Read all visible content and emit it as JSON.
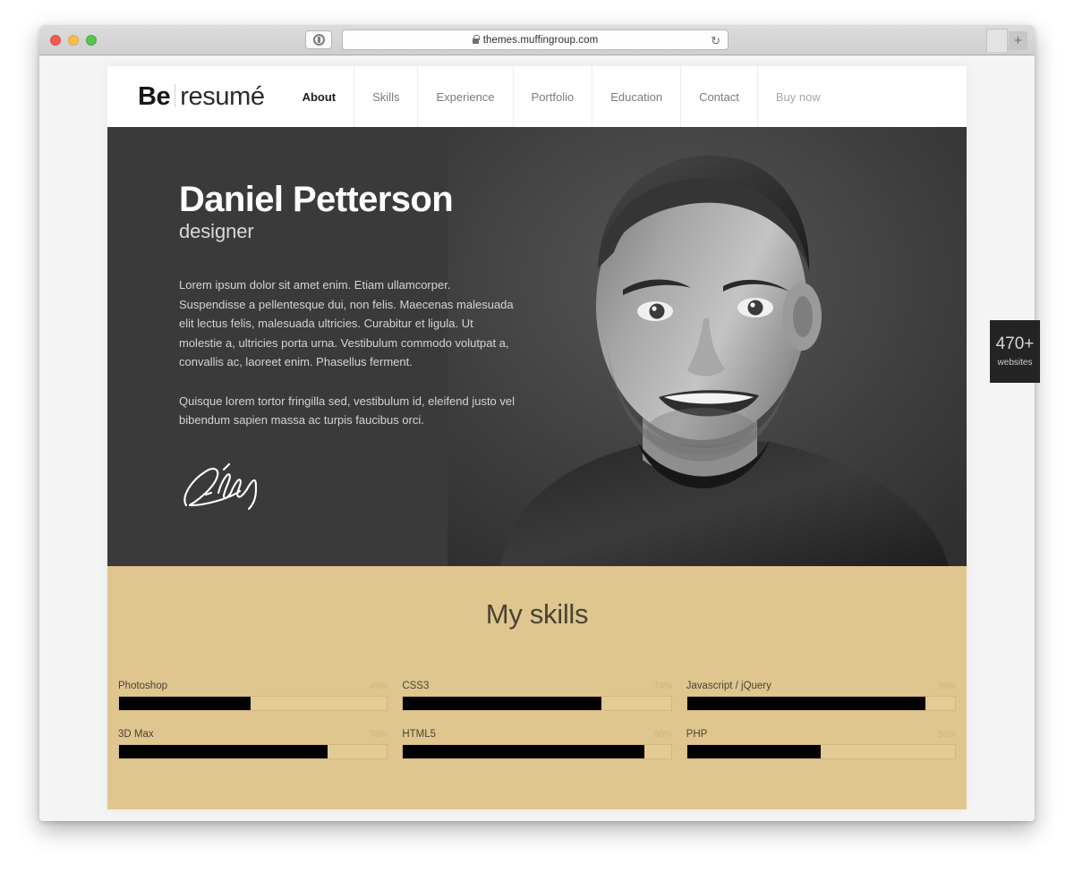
{
  "browser": {
    "url": "themes.muffingroup.com",
    "lock_icon": "lock-icon",
    "reader_icon": "reader-mode-icon",
    "reload_icon": "↻",
    "newtab_icon": "+",
    "traffic_lights": [
      "close-red",
      "minimize-yellow",
      "zoom-green"
    ]
  },
  "site": {
    "logo": {
      "bold": "Be",
      "light": "resumé"
    },
    "nav": [
      {
        "label": "About",
        "state": "active"
      },
      {
        "label": "Skills",
        "state": "default"
      },
      {
        "label": "Experience",
        "state": "default"
      },
      {
        "label": "Portfolio",
        "state": "default"
      },
      {
        "label": "Education",
        "state": "default"
      },
      {
        "label": "Contact",
        "state": "default"
      },
      {
        "label": "Buy now",
        "state": "muted"
      }
    ],
    "hero": {
      "name": "Daniel Petterson",
      "role": "designer",
      "paragraph1": "Lorem ipsum dolor sit amet enim. Etiam ullamcorper. Suspendisse a pellentesque dui, non felis. Maecenas malesuada elit lectus felis, malesuada ultricies. Curabitur et ligula. Ut molestie a, ultricies porta urna. Vestibulum commodo volutpat a, convallis ac, laoreet enim. Phasellus ferment.",
      "paragraph2": "Quisque lorem tortor fringilla sed, vestibulum id, eleifend justo vel bibendum sapien massa ac turpis faucibus orci.",
      "signature_alt": "signature",
      "photo_alt": "portrait-photo",
      "background_color": "#3a3a3a"
    },
    "skills": {
      "title": "My skills",
      "background_color": "#dfc68f",
      "bar_color": "#000000",
      "columns": [
        [
          {
            "name": "Photoshop",
            "percent": 49,
            "percent_label": "49%"
          },
          {
            "name": "3D Max",
            "percent": 78,
            "percent_label": "78%"
          }
        ],
        [
          {
            "name": "CSS3",
            "percent": 74,
            "percent_label": "74%"
          },
          {
            "name": "HTML5",
            "percent": 90,
            "percent_label": "90%"
          }
        ],
        [
          {
            "name": "Javascript / jQuery",
            "percent": 89,
            "percent_label": "89%"
          },
          {
            "name": "PHP",
            "percent": 50,
            "percent_label": "50%"
          }
        ]
      ]
    }
  },
  "side_badge": {
    "count": "470+",
    "label": "websites"
  }
}
